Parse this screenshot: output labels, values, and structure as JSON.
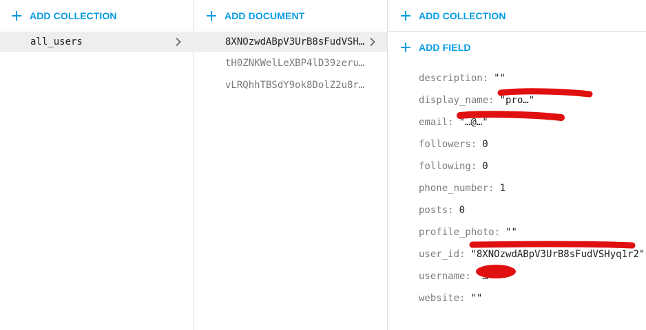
{
  "collections_panel": {
    "add_label": "ADD COLLECTION",
    "items": [
      {
        "label": "all_users"
      }
    ]
  },
  "documents_panel": {
    "add_label": "ADD DOCUMENT",
    "items": [
      {
        "label": "8XNOzwdABpV3UrB8sFudVSH…"
      },
      {
        "label": "tH0ZNKWelLeXBP4lD39zeru…"
      },
      {
        "label": "vLRQhhTBSdY9ok8DolZ2u8r…"
      }
    ]
  },
  "fields_panel": {
    "add_collection_label": "ADD COLLECTION",
    "add_field_label": "ADD FIELD",
    "fields": [
      {
        "key": "description:",
        "value": "\"\""
      },
      {
        "key": "display_name:",
        "value": "\"pro…\""
      },
      {
        "key": "email:",
        "value": "\"…@…\""
      },
      {
        "key": "followers:",
        "value": "0"
      },
      {
        "key": "following:",
        "value": "0"
      },
      {
        "key": "phone_number:",
        "value": "1"
      },
      {
        "key": "posts:",
        "value": "0"
      },
      {
        "key": "profile_photo:",
        "value": "\"\""
      },
      {
        "key": "user_id:",
        "value": "\"8XNOzwdABpV3UrB8sFudVSHyq1r2\""
      },
      {
        "key": "username:",
        "value": "\"…\""
      },
      {
        "key": "website:",
        "value": "\"\""
      }
    ]
  },
  "colors": {
    "accent": "#039be5",
    "redaction": "#e01010",
    "selected_row": "#eeeeee"
  }
}
